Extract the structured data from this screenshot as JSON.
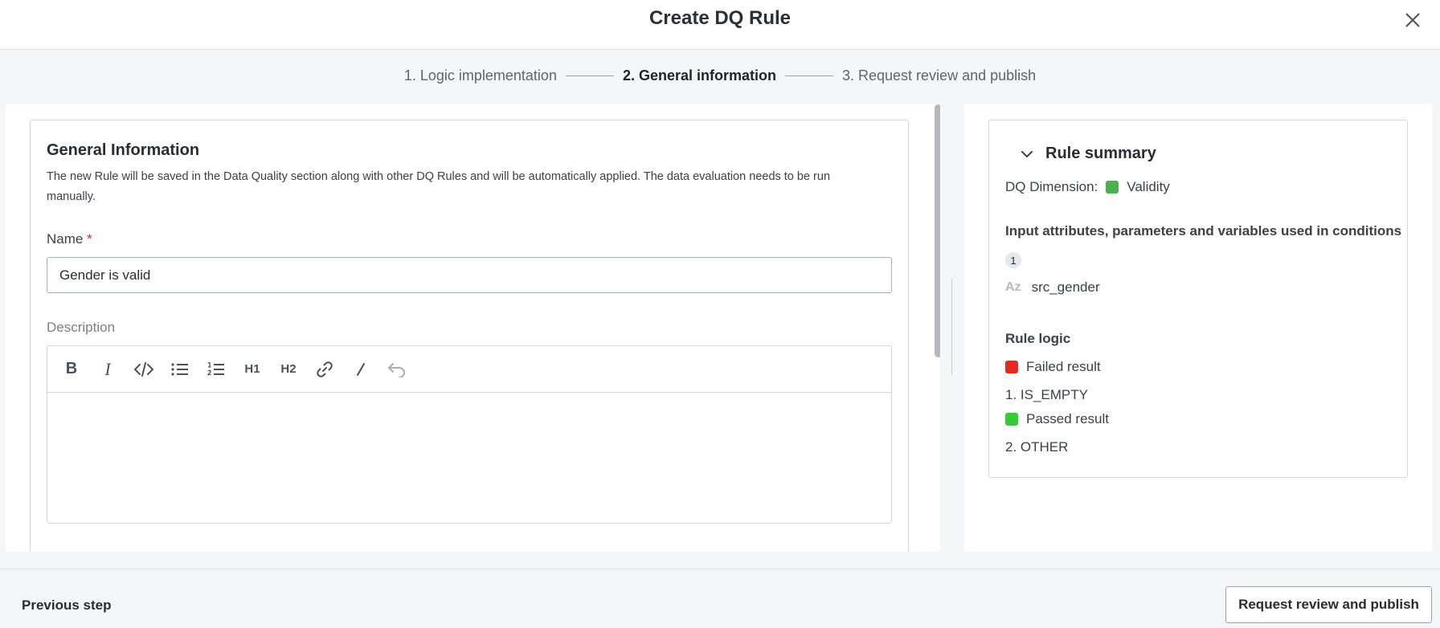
{
  "header": {
    "title": "Create DQ Rule"
  },
  "stepper": {
    "steps": [
      {
        "label": "1. Logic implementation",
        "state": "done"
      },
      {
        "label": "2. General information",
        "state": "active"
      },
      {
        "label": "3. Request review and publish",
        "state": "pending"
      }
    ]
  },
  "general_info": {
    "title": "General Information",
    "description": "The new Rule will be saved in the Data Quality section along with other DQ Rules and will be automatically applied. The data evaluation needs to be run manually.",
    "name_label": "Name",
    "required_marker": "*",
    "name_value": "Gender is valid",
    "description_label": "Description",
    "toolbar": {
      "bold": "B",
      "italic": "I",
      "h1": "H1",
      "h2": "H2"
    }
  },
  "summary": {
    "title": "Rule summary",
    "dimension_label": "DQ Dimension:",
    "dimension_value": "Validity",
    "dimension_color": "#4caf50",
    "inputs_heading": "Input attributes, parameters and variables used in conditions",
    "inputs_count": "1",
    "attribute_type": "Az",
    "attribute_name": "src_gender",
    "logic_heading": "Rule logic",
    "failed_label": "Failed result",
    "failed_color": "#e02b1d",
    "failed_condition": "1. IS_EMPTY",
    "passed_label": "Passed result",
    "passed_color": "#33cc33",
    "passed_condition": "2. OTHER"
  },
  "footer": {
    "previous_label": "Previous step",
    "publish_label": "Request review and publish"
  },
  "icons": {
    "close": "close-icon",
    "collapse": "chevron-down-icon",
    "code": "code-icon",
    "bullet_list": "bullet-list-icon",
    "numbered_list": "numbered-list-icon",
    "link": "link-icon",
    "clear_format": "clear-format-icon",
    "undo": "undo-icon"
  }
}
